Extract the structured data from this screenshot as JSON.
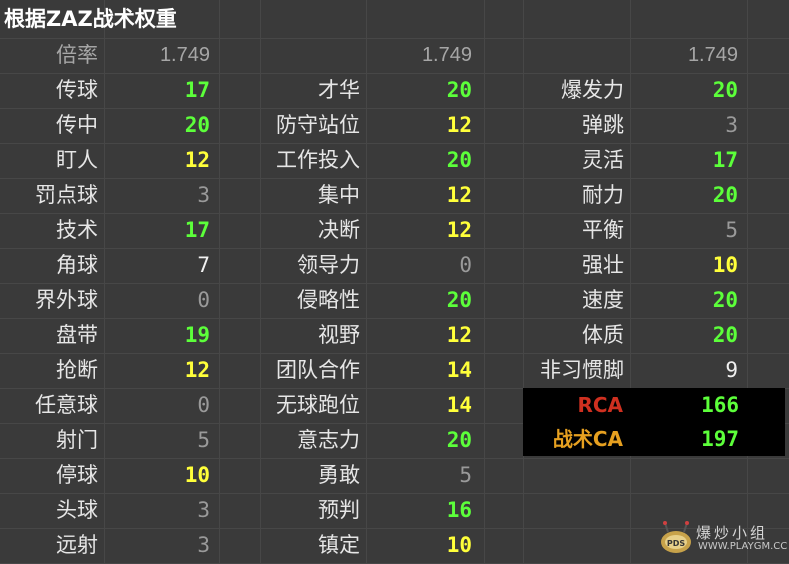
{
  "sheet": {
    "title": "根据ZAZ战术权重",
    "ratio_label": "倍率",
    "ratio_values": [
      "1.749",
      "1.749",
      "1.749"
    ]
  },
  "colors": {
    "green": "#5cff3a",
    "yellow": "#ffff3a",
    "gray": "#9a9a9a",
    "white": "#f0f0f0",
    "rca_label": "#d03020",
    "ca_label": "#e6a020"
  },
  "columns": [
    [
      {
        "label": "传球",
        "value": "17",
        "tone": "green"
      },
      {
        "label": "传中",
        "value": "20",
        "tone": "green"
      },
      {
        "label": "盯人",
        "value": "12",
        "tone": "yellow"
      },
      {
        "label": "罚点球",
        "value": "3",
        "tone": "gray"
      },
      {
        "label": "技术",
        "value": "17",
        "tone": "green"
      },
      {
        "label": "角球",
        "value": "7",
        "tone": "white"
      },
      {
        "label": "界外球",
        "value": "0",
        "tone": "gray"
      },
      {
        "label": "盘带",
        "value": "19",
        "tone": "green"
      },
      {
        "label": "抢断",
        "value": "12",
        "tone": "yellow"
      },
      {
        "label": "任意球",
        "value": "0",
        "tone": "gray"
      },
      {
        "label": "射门",
        "value": "5",
        "tone": "gray"
      },
      {
        "label": "停球",
        "value": "10",
        "tone": "yellow"
      },
      {
        "label": "头球",
        "value": "3",
        "tone": "gray"
      },
      {
        "label": "远射",
        "value": "3",
        "tone": "gray"
      }
    ],
    [
      {
        "label": "才华",
        "value": "20",
        "tone": "green"
      },
      {
        "label": "防守站位",
        "value": "12",
        "tone": "yellow"
      },
      {
        "label": "工作投入",
        "value": "20",
        "tone": "green"
      },
      {
        "label": "集中",
        "value": "12",
        "tone": "yellow"
      },
      {
        "label": "决断",
        "value": "12",
        "tone": "yellow"
      },
      {
        "label": "领导力",
        "value": "0",
        "tone": "gray"
      },
      {
        "label": "侵略性",
        "value": "20",
        "tone": "green"
      },
      {
        "label": "视野",
        "value": "12",
        "tone": "yellow"
      },
      {
        "label": "团队合作",
        "value": "14",
        "tone": "yellow"
      },
      {
        "label": "无球跑位",
        "value": "14",
        "tone": "yellow"
      },
      {
        "label": "意志力",
        "value": "20",
        "tone": "green"
      },
      {
        "label": "勇敢",
        "value": "5",
        "tone": "gray"
      },
      {
        "label": "预判",
        "value": "16",
        "tone": "green"
      },
      {
        "label": "镇定",
        "value": "10",
        "tone": "yellow"
      }
    ],
    [
      {
        "label": "爆发力",
        "value": "20",
        "tone": "green"
      },
      {
        "label": "弹跳",
        "value": "3",
        "tone": "gray"
      },
      {
        "label": "灵活",
        "value": "17",
        "tone": "green"
      },
      {
        "label": "耐力",
        "value": "20",
        "tone": "green"
      },
      {
        "label": "平衡",
        "value": "5",
        "tone": "gray"
      },
      {
        "label": "强壮",
        "value": "10",
        "tone": "yellow"
      },
      {
        "label": "速度",
        "value": "20",
        "tone": "green"
      },
      {
        "label": "体质",
        "value": "20",
        "tone": "green"
      },
      {
        "label": "非习惯脚",
        "value": "9",
        "tone": "white"
      }
    ]
  ],
  "summary": [
    {
      "label": "RCA",
      "value": "166",
      "label_tone": "rca_label"
    },
    {
      "label": "战术CA",
      "value": "197",
      "label_tone": "ca_label"
    }
  ],
  "watermark": {
    "text": "爆炒小组",
    "url": "WWW.PLAYGM.CC",
    "badge": "PDS"
  }
}
